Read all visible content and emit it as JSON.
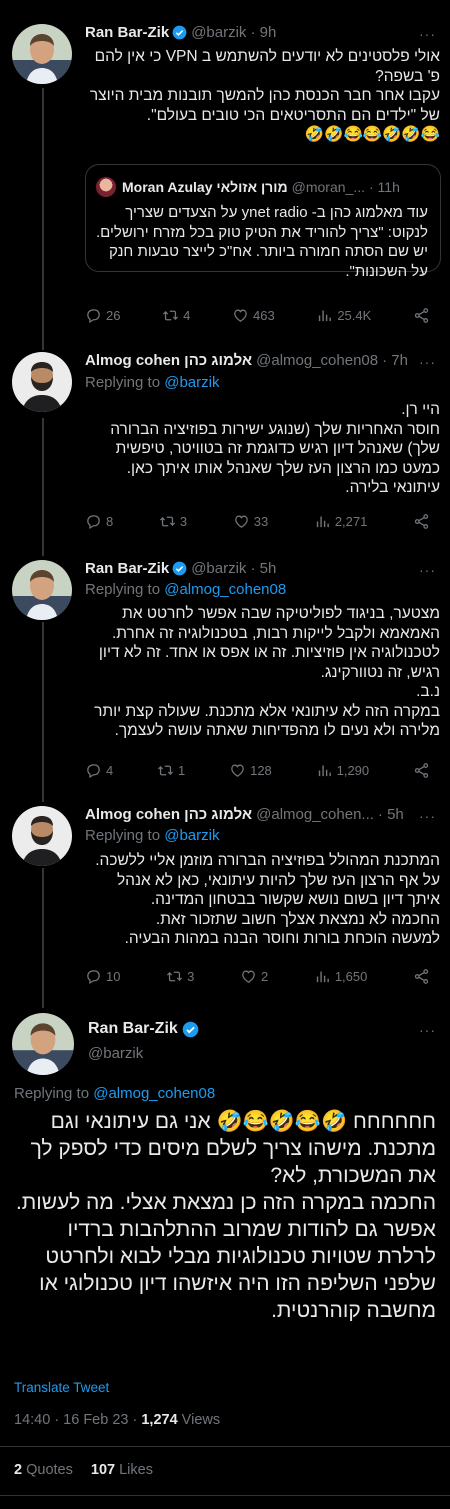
{
  "tweets": [
    {
      "name": "Ran Bar-Zik",
      "handle": "@barzik",
      "time": "· 9h",
      "text": "אולי פלסטינים לא יודעים להשתמש ב VPN כי אין להם פ' בשפה?\nעקבו אחר חבר הכנסת כהן להמשך תובנות מבית היוצר של \"ילדים הם התסריטאים הכי טובים בעולם\".\n😂🤣🤣😂😂🤣🤣",
      "quote": {
        "name": "Moran Azulay מורן אזולאי",
        "handle": "@moran_...",
        "time": "· 11h",
        "text": "עוד מאלמוג כהן ב- ynet radio על הצעדים שצריך לנקוט: \"צריך להוריד את הטיק טוק בכל מזרח ירושלים. יש שם הסתה חמורה ביותר. אח\"כ לייצר טבעות חנק על השכונות\"."
      },
      "replies": "26",
      "retweets": "4",
      "likes": "463",
      "views": "25.4K"
    },
    {
      "name": "Almog cohen אלמוג כהן",
      "handle": "@almog_cohen08",
      "time": "· 7h",
      "replying_prefix": "Replying to ",
      "replying_to": "@barzik",
      "text": "היי רן.\nחוסר האחריות שלך (שנוגע ישירות בפוזיציה הברורה שלך) שאנהל דיון רגיש כדוגמת זה בטוויטר, טיפשית כמעט כמו הרצון העז שלך שאנהל אותו איתך כאן. עיתונאי בלירה.",
      "replies": "8",
      "retweets": "3",
      "likes": "33",
      "views": "2,271"
    },
    {
      "name": "Ran Bar-Zik",
      "handle": "@barzik",
      "time": "· 5h",
      "replying_prefix": "Replying to ",
      "replying_to": "@almog_cohen08",
      "text": "מצטער, בניגוד לפוליטיקה שבה אפשר לחרטט את האמאמא ולקבל לייקות רבות, בטכנולוגיה זה אחרת. לטכנולוגיה אין פוזיציות. זה או אפס או אחד. זה לא דיון רגיש, זה נטוורקינג.\nנ.ב.\nבמקרה הזה לא עיתונאי אלא מתכנת. שעולה קצת יותר מלירה ולא נעים לו מהפדיחות שאתה עושה לעצמך.",
      "replies": "4",
      "retweets": "1",
      "likes": "128",
      "views": "1,290"
    },
    {
      "name": "Almog cohen אלמוג כהן",
      "handle": "@almog_cohen...",
      "time": "· 5h",
      "replying_prefix": "Replying to ",
      "replying_to": "@barzik",
      "text": "המתכנת המהולל בפוזיציה הברורה מוזמן אליי ללשכה.\nעל אף הרצון העז שלך להיות עיתונאי, כאן לא אנהל איתך דיון בשום נושא שקשור בבטחון המדינה.\nהחכמה לא נמצאת אצלך חשוב שתזכור זאת.\nלמעשה הוכחת בורות וחוסר הבנה במהות הבעיה.",
      "replies": "10",
      "retweets": "3",
      "likes": "2",
      "views": "1,650"
    }
  ],
  "main": {
    "name": "Ran Bar-Zik",
    "handle": "@barzik",
    "replying_prefix": "Replying to ",
    "replying_to": "@almog_cohen08",
    "text": "חחחחחח 🤣😂🤣😂🤣 אני גם עיתונאי וגם מתכנת. מישהו צריך לשלם מיסים כדי לספק לך את המשכורת, לא?\nהחכמה במקרה הזה כן נמצאת אצלי. מה לעשות. אפשר גם להודות שמרוב ההתלהבות ברדיו לרלרת שטויות טכנולוגיות מבלי לבוא ולחרטט שלפני השליפה הזו היה איזשהו דיון טכנולוגי או מחשבה קוהרנטית.",
    "translate": "Translate Tweet",
    "time": "14:40 · 16 Feb 23 · ",
    "views_count": "1,274",
    "views_label": " Views",
    "quotes_count": "2",
    "quotes_label": " Quotes",
    "likes_count": "107",
    "likes_label": " Likes"
  },
  "colors": {
    "accent": "#1d9bf0",
    "muted": "#71767b",
    "text": "#e7e9ea",
    "bg": "#000000"
  }
}
